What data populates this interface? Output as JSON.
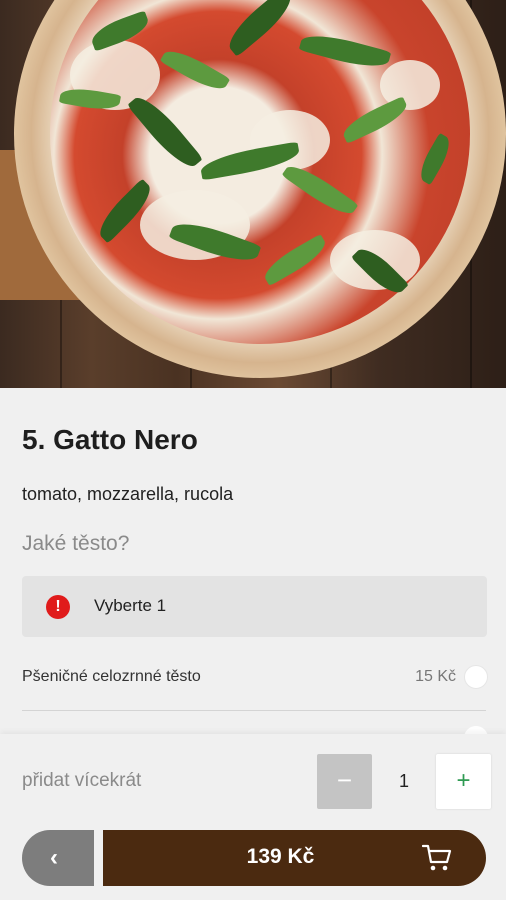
{
  "product": {
    "title": "5. Gatto Nero",
    "description": "tomato, mozzarella, rucola"
  },
  "options_group": {
    "question": "Jaké těsto?",
    "required_icon": "!",
    "required_text": "Vyberte 1",
    "options": [
      {
        "label": "Pšeničné celozrnné těsto",
        "price": "15 Kč"
      }
    ]
  },
  "quantity": {
    "label": "přidat vícekrát",
    "minus": "−",
    "value": "1",
    "plus": "+"
  },
  "footer": {
    "back_icon": "chevron-left-icon",
    "back_label": "‹",
    "price": "139 Kč",
    "cart_icon": "shopping-cart-icon"
  },
  "colors": {
    "accent_brown": "#4b2a10",
    "error_red": "#e01b1b",
    "plus_green": "#2e9a52"
  }
}
